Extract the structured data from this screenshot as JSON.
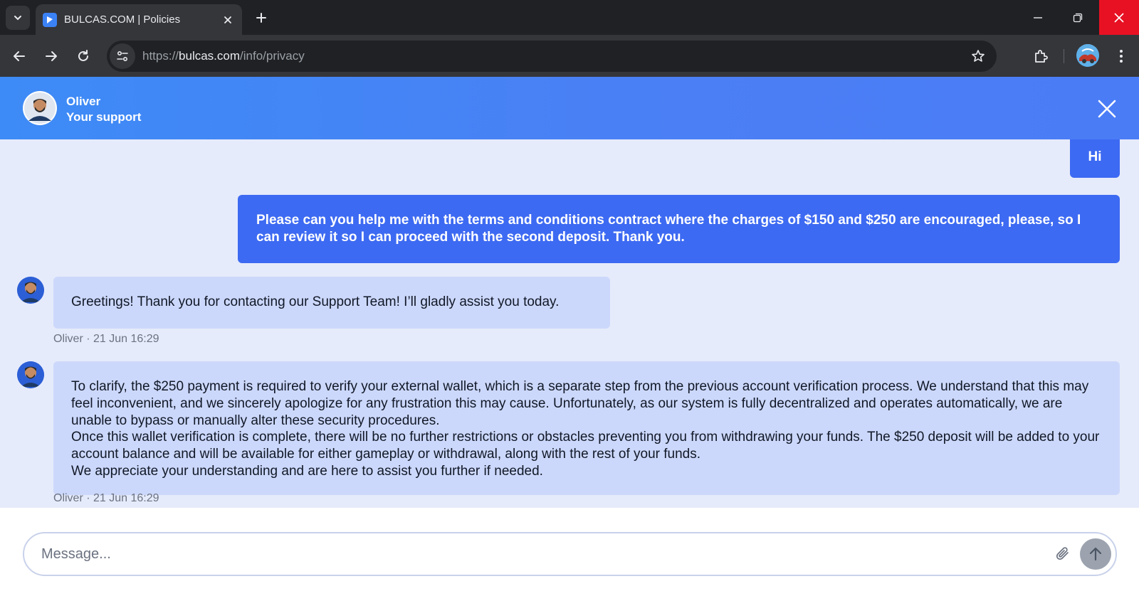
{
  "browser": {
    "tab_title": "BULCAS.COM | Policies",
    "url_scheme": "https://",
    "url_host": "bulcas.com",
    "url_path": "/info/privacy"
  },
  "chat": {
    "agent_name": "Oliver",
    "agent_role": "Your support",
    "messages": [
      {
        "from": "user",
        "text": "Hi"
      },
      {
        "from": "user",
        "text": "Please can you help me with the terms and conditions contract where the charges of $150 and $250 are encouraged, please, so I can review it so I can proceed with the second deposit. Thank you."
      },
      {
        "from": "agent",
        "text": "Greetings! Thank you for contacting our Support Team! I’ll gladly assist you today.",
        "meta": "Oliver · 21 Jun 16:29"
      },
      {
        "from": "agent",
        "paragraphs": [
          "To clarify, the $250 payment is required to verify your external wallet, which is a separate step from the previous account verification process. We understand that this may feel inconvenient, and we sincerely apologize for any frustration this may cause. Unfortunately, as our system is fully decentralized and operates automatically, we are unable to bypass or manually alter these security procedures.",
          "Once this wallet verification is complete, there will be no further restrictions or obstacles preventing you from withdrawing your funds. The $250 deposit will be added to your account balance and will be available for either gameplay or withdrawal, along with the rest of your funds.",
          "We appreciate your understanding and are here to assist you further if needed."
        ],
        "meta": "Oliver · 21 Jun 16:29"
      }
    ],
    "composer_placeholder": "Message..."
  },
  "colors": {
    "header_blue": "#4a7cf6",
    "user_bubble": "#3d6af2",
    "agent_bubble": "#ccd8fb",
    "chat_background": "#e6ebfb",
    "close_red": "#e81123"
  },
  "icons": [
    "tab-search-icon",
    "favicon-icon",
    "close-icon",
    "plus-icon",
    "minimize-icon",
    "restore-icon",
    "back-arrow-icon",
    "forward-arrow-icon",
    "reload-icon",
    "site-info-icon",
    "star-icon",
    "extensions-icon",
    "more-vert-icon",
    "paperclip-icon",
    "arrow-up-icon"
  ]
}
